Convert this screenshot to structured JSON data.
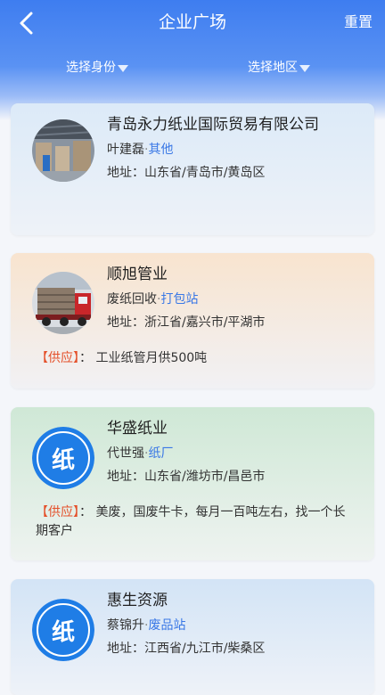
{
  "header": {
    "title": "企业广场",
    "reset_label": "重置",
    "filters": {
      "identity": "选择身份",
      "region": "选择地区"
    }
  },
  "companies": [
    {
      "name": "青岛永力纸业国际贸易有限公司",
      "person": "叶建磊",
      "type": "其他",
      "address_label": "地址：",
      "address": "山东省/青岛市/黄岛区",
      "supply_tag": "",
      "supply": "",
      "avatar": "warehouse-photo"
    },
    {
      "name": "顺旭管业",
      "person": "废纸回收",
      "type": "打包站",
      "address_label": "地址：",
      "address": "浙江省/嘉兴市/平湖市",
      "supply_tag": "【供应】",
      "supply": "：  工业纸管月供500吨",
      "avatar": "truck-photo"
    },
    {
      "name": "华盛纸业",
      "person": "代世强",
      "type": "纸厂",
      "address_label": "地址：",
      "address": "山东省/潍坊市/昌邑市",
      "supply_tag": "【供应】",
      "supply": "：  美废，国废牛卡，每月一百吨左右，找一个长期客户",
      "avatar": "paper-logo",
      "logo_char": "纸"
    },
    {
      "name": "惠生资源",
      "person": "蔡锦升",
      "type": "废品站",
      "address_label": "地址：",
      "address": "江西省/九江市/柴桑区",
      "supply_tag": "",
      "supply": "",
      "avatar": "paper-logo",
      "logo_char": "纸"
    }
  ],
  "colors": {
    "header_blue": "#3e7df0",
    "type_link": "#3a78e6",
    "supply_tag": "#e4502a",
    "logo_blue": "#1f7de6"
  }
}
